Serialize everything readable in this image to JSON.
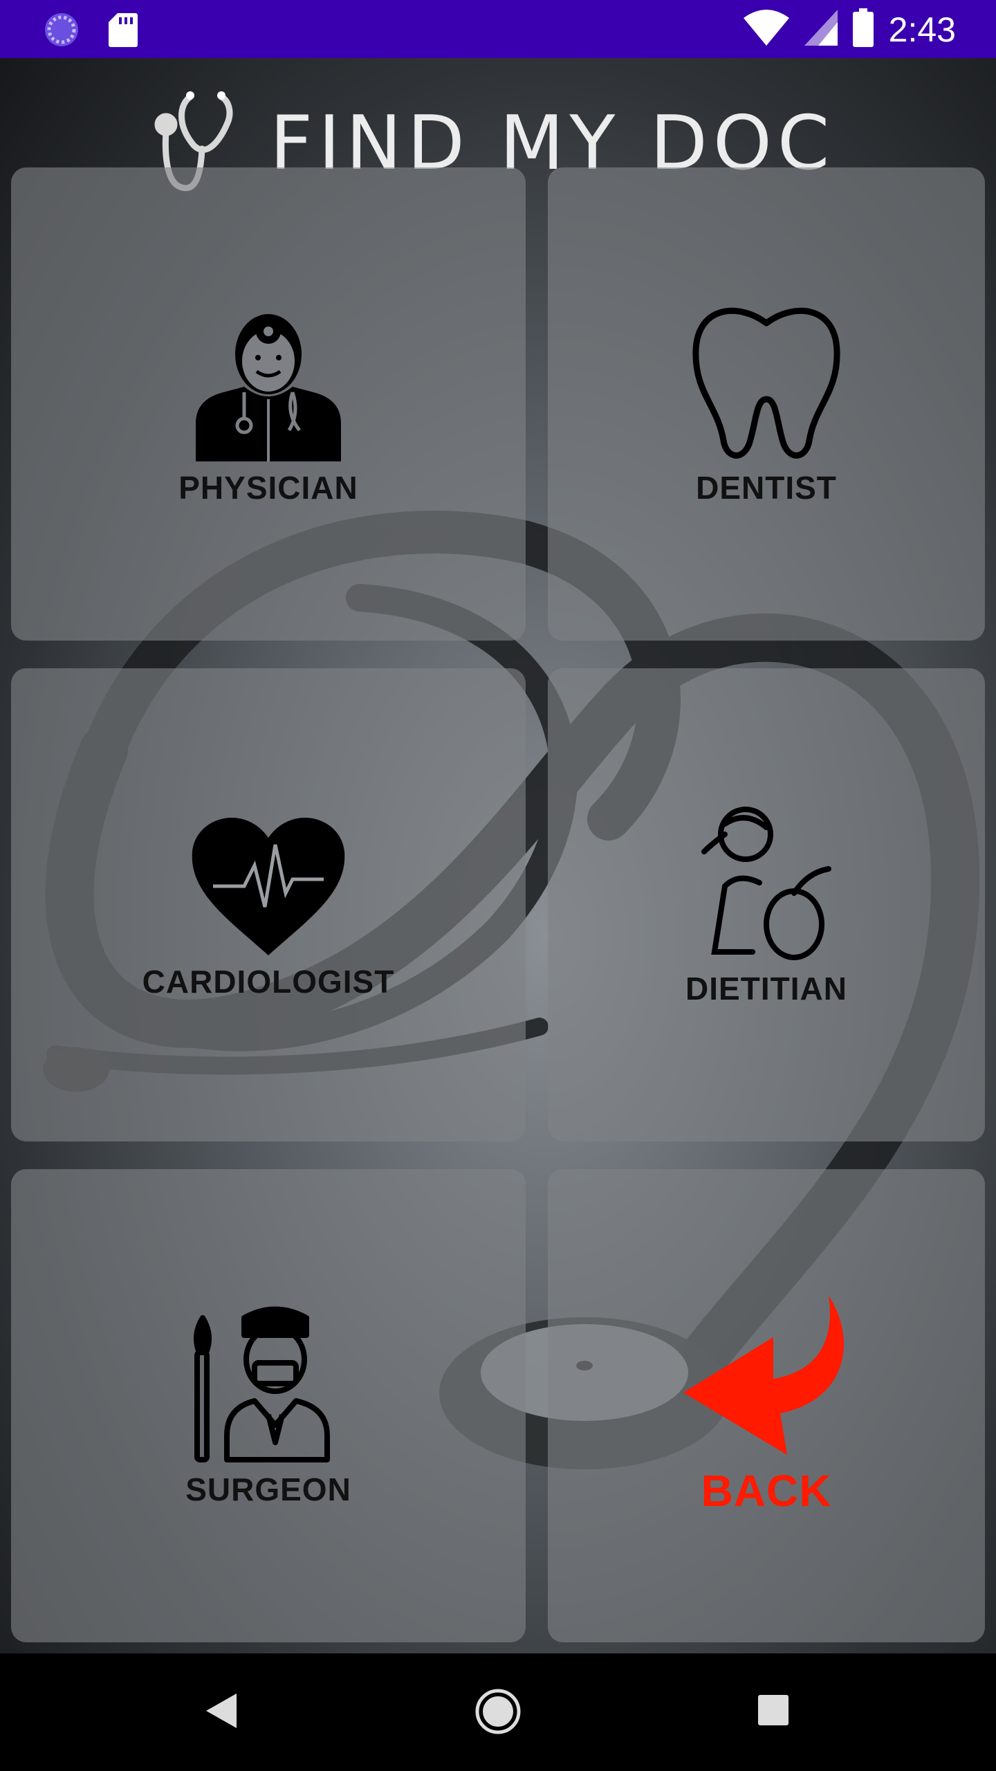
{
  "status_bar": {
    "time": "2:43",
    "icons": [
      "spinner-icon",
      "sd-card-icon",
      "wifi-icon",
      "signal-icon",
      "battery-icon"
    ],
    "background": "#3a00b0"
  },
  "header": {
    "title": "FIND MY DOC",
    "icon": "stethoscope-icon"
  },
  "tiles": [
    {
      "label": "PHYSICIAN",
      "icon": "physician-icon"
    },
    {
      "label": "DENTIST",
      "icon": "tooth-icon"
    },
    {
      "label": "CARDIOLOGIST",
      "icon": "heart-pulse-icon"
    },
    {
      "label": "DIETITIAN",
      "icon": "dietitian-icon"
    },
    {
      "label": "SURGEON",
      "icon": "surgeon-icon"
    },
    {
      "label": "BACK",
      "icon": "back-arrow-icon",
      "color": "#ff1a00"
    }
  ],
  "nav_bar": {
    "buttons": [
      "back-triangle-icon",
      "home-circle-icon",
      "recents-square-icon"
    ]
  }
}
